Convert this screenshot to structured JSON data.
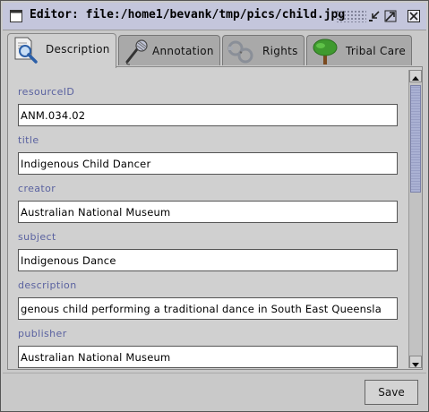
{
  "window": {
    "title": "Editor: file:/home1/bevank/tmp/pics/child.jpg"
  },
  "tabs": [
    {
      "label": "Description",
      "icon": "magnifier-document-icon",
      "active": true
    },
    {
      "label": "Annotation",
      "icon": "microphone-icon",
      "active": false
    },
    {
      "label": "Rights",
      "icon": "handcuffs-icon",
      "active": false
    },
    {
      "label": "Tribal Care",
      "icon": "tree-icon",
      "active": false
    }
  ],
  "fields": [
    {
      "label": "resourceID",
      "value": "ANM.034.02"
    },
    {
      "label": "title",
      "value": "Indigenous Child Dancer"
    },
    {
      "label": "creator",
      "value": "Australian National Museum"
    },
    {
      "label": "subject",
      "value": "Indigenous Dance"
    },
    {
      "label": "description",
      "value": "genous child performing a traditional dance in South East Queensla"
    },
    {
      "label": "publisher",
      "value": "Australian National Museum"
    }
  ],
  "footer": {
    "save_label": "Save"
  },
  "colors": {
    "label_text": "#5a62a0",
    "titlebar": "#c4c6dc",
    "scroll_thumb": "#aab1d3"
  }
}
